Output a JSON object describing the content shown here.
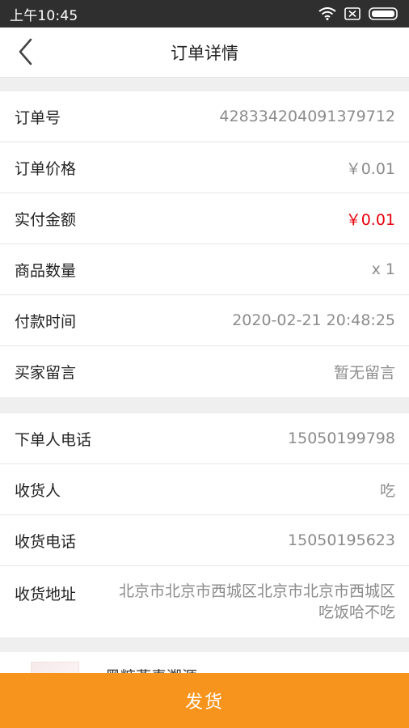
{
  "status_bar": {
    "time": "上午10:45",
    "icons": [
      "wifi-icon",
      "sim-icon",
      "battery-icon"
    ]
  },
  "header": {
    "title": "订单详情",
    "back_icon": "chevron-left-icon"
  },
  "order_section": [
    {
      "label": "订单号",
      "value": "428334204091379712"
    },
    {
      "label": "订单价格",
      "value": "￥0.01"
    },
    {
      "label": "实付金额",
      "value": "￥0.01"
    },
    {
      "label": "商品数量",
      "value": "x 1"
    },
    {
      "label": "付款时间",
      "value": "2020-02-21 20:48:25"
    },
    {
      "label": "买家留言",
      "value": "暂无留言"
    }
  ],
  "contact_section": [
    {
      "label": "下单人电话",
      "value": "15050199798"
    },
    {
      "label": "收货人",
      "value": "吃"
    },
    {
      "label": "收货电话",
      "value": "15050195623"
    },
    {
      "label": "收货地址",
      "value": "北京市北京市西城区北京市北京市西城区吃饭哈不吃"
    }
  ],
  "product": {
    "title": "黑糖燕麦溯源"
  },
  "footer": {
    "ship_button_label": "发货"
  },
  "colors": {
    "accent": "#f7941d",
    "price_red": "#e8000b",
    "status_bar": "#2f2f2f"
  }
}
